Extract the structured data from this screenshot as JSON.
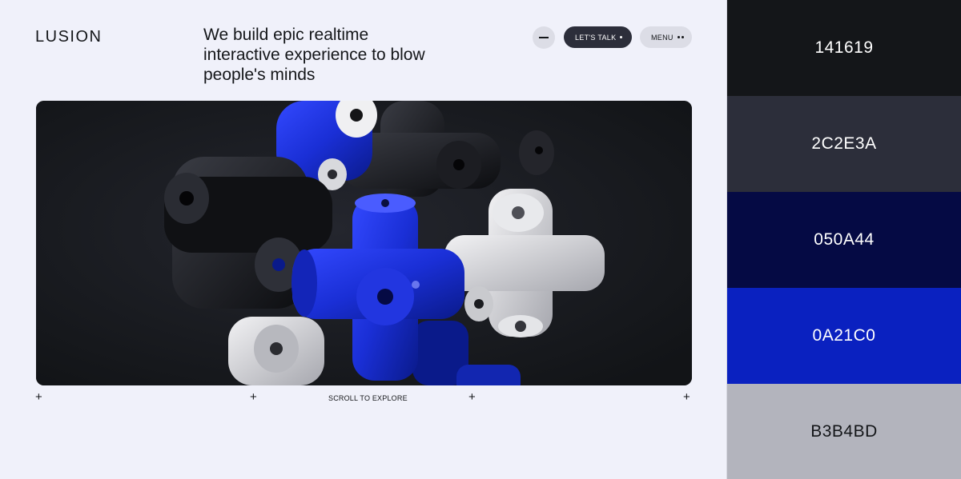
{
  "site": {
    "logo": "LUSION",
    "tagline": "We build epic realtime interactive experience to blow people's minds",
    "buttons": {
      "talk_label": "LET'S TALK",
      "menu_label": "MENU"
    },
    "scroll_label": "SCROLL TO EXPLORE",
    "plus_glyph": "+",
    "icons": [
      "minus-icon",
      "dot-icon",
      "two-dots-icon",
      "plus-icon"
    ]
  },
  "palette": {
    "swatches": [
      {
        "label": "141619",
        "color": "#141619",
        "text_color": "#ffffff"
      },
      {
        "label": "2C2E3A",
        "color": "#2C2E3A",
        "text_color": "#ffffff"
      },
      {
        "label": "050A44",
        "color": "#050A44",
        "text_color": "#ffffff"
      },
      {
        "label": "0A21C0",
        "color": "#0A21C0",
        "text_color": "#ffffff"
      },
      {
        "label": "B3B4BD",
        "color": "#B3B4BD",
        "text_color": "#141619"
      }
    ]
  }
}
